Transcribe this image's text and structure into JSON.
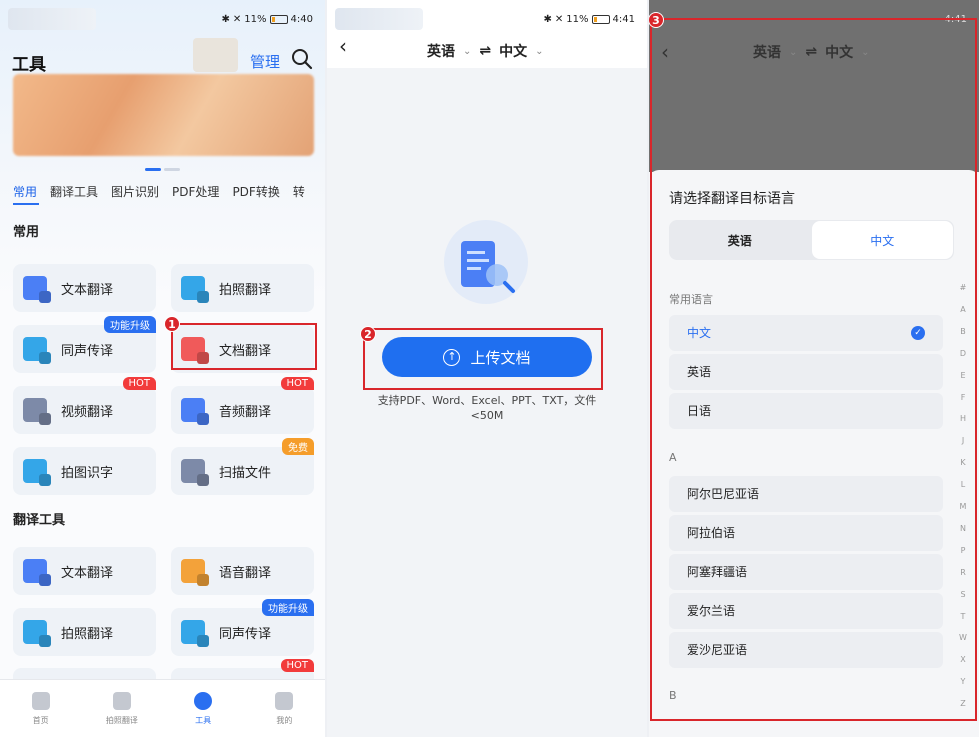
{
  "colors": {
    "accent": "#2a6ff0",
    "highlight": "#d9262b",
    "hot": "#f23b3b",
    "free": "#f59d2a"
  },
  "status": {
    "p1_time": "4:40",
    "p2_time": "4:41",
    "p3_time": "4:41",
    "battery": "11%"
  },
  "panel1": {
    "title": "工具",
    "manage": "管理",
    "category_tabs": [
      "常用",
      "翻译工具",
      "图片识别",
      "PDF处理",
      "PDF转换",
      "转"
    ],
    "section_common": "常用",
    "section_translate": "翻译工具",
    "cards": [
      {
        "label": "文本翻译",
        "icon": "text-translate-icon"
      },
      {
        "label": "拍照翻译",
        "icon": "photo-translate-icon"
      },
      {
        "label": "同声传译",
        "icon": "simultaneous-interpret-icon",
        "badge": "功能升级"
      },
      {
        "label": "文档翻译",
        "icon": "document-translate-icon"
      },
      {
        "label": "视频翻译",
        "icon": "video-translate-icon",
        "badge": "HOT"
      },
      {
        "label": "音频翻译",
        "icon": "audio-translate-icon",
        "badge": "HOT"
      },
      {
        "label": "拍图识字",
        "icon": "image-ocr-icon"
      },
      {
        "label": "扫描文件",
        "icon": "scan-file-icon",
        "badge": "免费"
      },
      {
        "label": "文本翻译",
        "icon": "text-translate-icon"
      },
      {
        "label": "语音翻译",
        "icon": "voice-translate-icon"
      },
      {
        "label": "拍照翻译",
        "icon": "photo-translate-icon"
      },
      {
        "label": "同声传译",
        "icon": "simultaneous-interpret-icon",
        "badge": "功能升级"
      },
      {
        "label": "",
        "icon": "",
        "badge": "HOT"
      }
    ],
    "nav": [
      "首页",
      "拍照翻译",
      "工具",
      "我的"
    ]
  },
  "panel2": {
    "source_lang": "英语",
    "target_lang": "中文",
    "swap": "⇌",
    "upload_label": "上传文档",
    "upload_note": "支持PDF、Word、Excel、PPT、TXT，文件<50M"
  },
  "panel3": {
    "source_lang": "英语",
    "target_lang": "中文",
    "sheet_title": "请选择翻译目标语言",
    "seg_left": "英语",
    "seg_right": "中文",
    "common_group": "常用语言",
    "common_langs": [
      "中文",
      "英语",
      "日语"
    ],
    "group_a": "A",
    "a_langs": [
      "阿尔巴尼亚语",
      "阿拉伯语",
      "阿塞拜疆语",
      "爱尔兰语",
      "爱沙尼亚语"
    ],
    "group_b": "B",
    "index_letters": [
      "#",
      "A",
      "B",
      "D",
      "E",
      "F",
      "H",
      "J",
      "K",
      "L",
      "M",
      "N",
      "P",
      "R",
      "S",
      "T",
      "W",
      "X",
      "Y",
      "Z"
    ]
  },
  "markers": [
    "1",
    "2",
    "3"
  ]
}
